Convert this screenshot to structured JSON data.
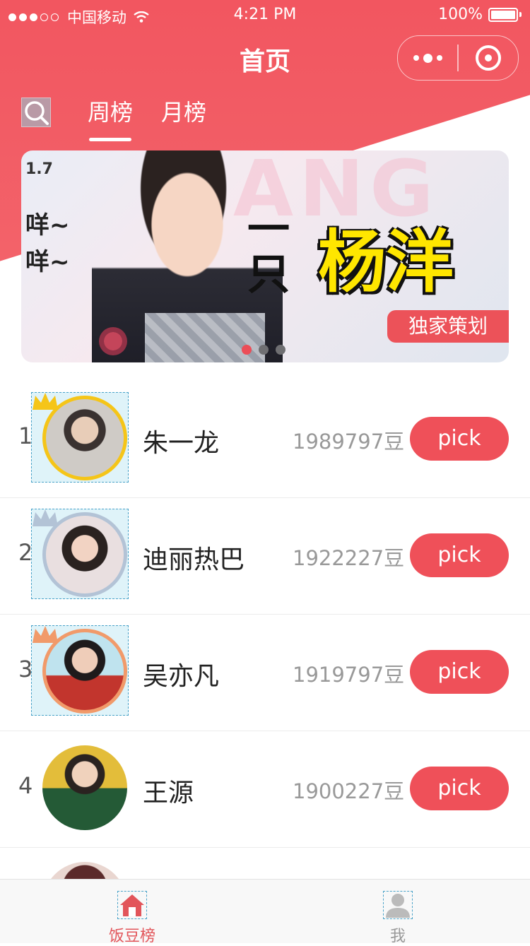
{
  "status_bar": {
    "carrier": "中国移动",
    "time": "4:21 PM",
    "battery": "100%"
  },
  "nav": {
    "title": "首页"
  },
  "tabs": [
    {
      "label": "周榜",
      "active": true
    },
    {
      "label": "月榜",
      "active": false
    }
  ],
  "banner": {
    "side_text_1": "咩~",
    "side_text_2": "咩~",
    "date_text": "1.7",
    "ghost_text": "ANG",
    "headline_prefix": "一只",
    "headline_name": "杨洋",
    "tag": "独家策划",
    "pagination_total": 3,
    "pagination_active": 1
  },
  "ranking": [
    {
      "rank": "1",
      "name": "朱一龙",
      "score": "1989797豆",
      "button": "pick",
      "crown": "gold"
    },
    {
      "rank": "2",
      "name": "迪丽热巴",
      "score": "1922227豆",
      "button": "pick",
      "crown": "silver"
    },
    {
      "rank": "3",
      "name": "吴亦凡",
      "score": "1919797豆",
      "button": "pick",
      "crown": "bronze"
    },
    {
      "rank": "4",
      "name": "王源",
      "score": "1900227豆",
      "button": "pick",
      "crown": ""
    }
  ],
  "tabbar": [
    {
      "label": "饭豆榜",
      "icon": "home-icon",
      "active": true
    },
    {
      "label": "我",
      "icon": "user-icon",
      "active": false
    }
  ],
  "colors": {
    "brand_red": "#f25660",
    "crown_gold": "#f5c518",
    "crown_silver": "#b3c3d6",
    "crown_bronze": "#f19a6a",
    "tab_active": "#e2555a",
    "tab_inactive": "#999999"
  }
}
